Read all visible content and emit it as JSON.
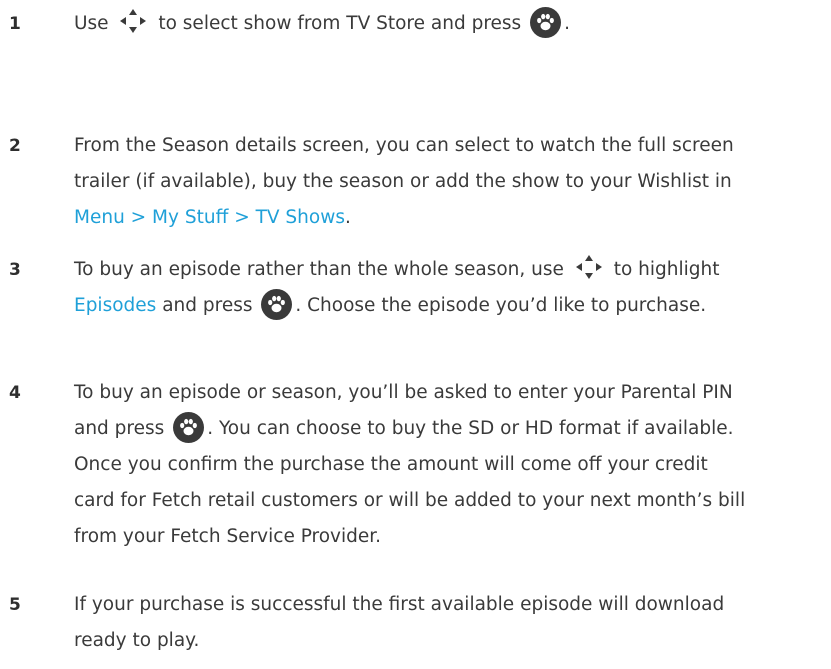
{
  "steps": [
    {
      "number": "1",
      "lines": [
        {
          "before": "Use",
          "mid": "to select show from TV Store and press",
          "after": "."
        }
      ]
    },
    {
      "number": "2",
      "line1": "From the Season details screen, you can select to watch the full screen",
      "line2": "trailer (if available), buy the season or add the show to your Wishlist in",
      "link": "Menu > My Stuff > TV Shows",
      "link_after": "."
    },
    {
      "number": "3",
      "line1_before": "To buy an episode rather than the whole season, use",
      "line1_after": "to highlight",
      "link": "Episodes",
      "line2_mid": "and press",
      "line2_after": ". Choose the episode you’d like to purchase."
    },
    {
      "number": "4",
      "line1": "To buy an episode or season, you’ll be asked to enter your Parental PIN",
      "line2_before": "and press",
      "line2_after": ". You can choose to buy the SD or HD format if available.",
      "line3": "Once you confirm the purchase the amount will come off your credit",
      "line4": "card for Fetch retail customers or will be added to your next month’s bill",
      "line5": "from your Fetch Service Provider."
    },
    {
      "number": "5",
      "line1": "If your purchase is successful the first available episode will download",
      "line2": "ready to play."
    }
  ],
  "colors": {
    "text": "#3a3a3a",
    "link": "#1fa0d8",
    "button": "#3a3a3a"
  },
  "icons": {
    "nav": "directional-arrows-icon",
    "ok": "paw-ok-button-icon"
  }
}
